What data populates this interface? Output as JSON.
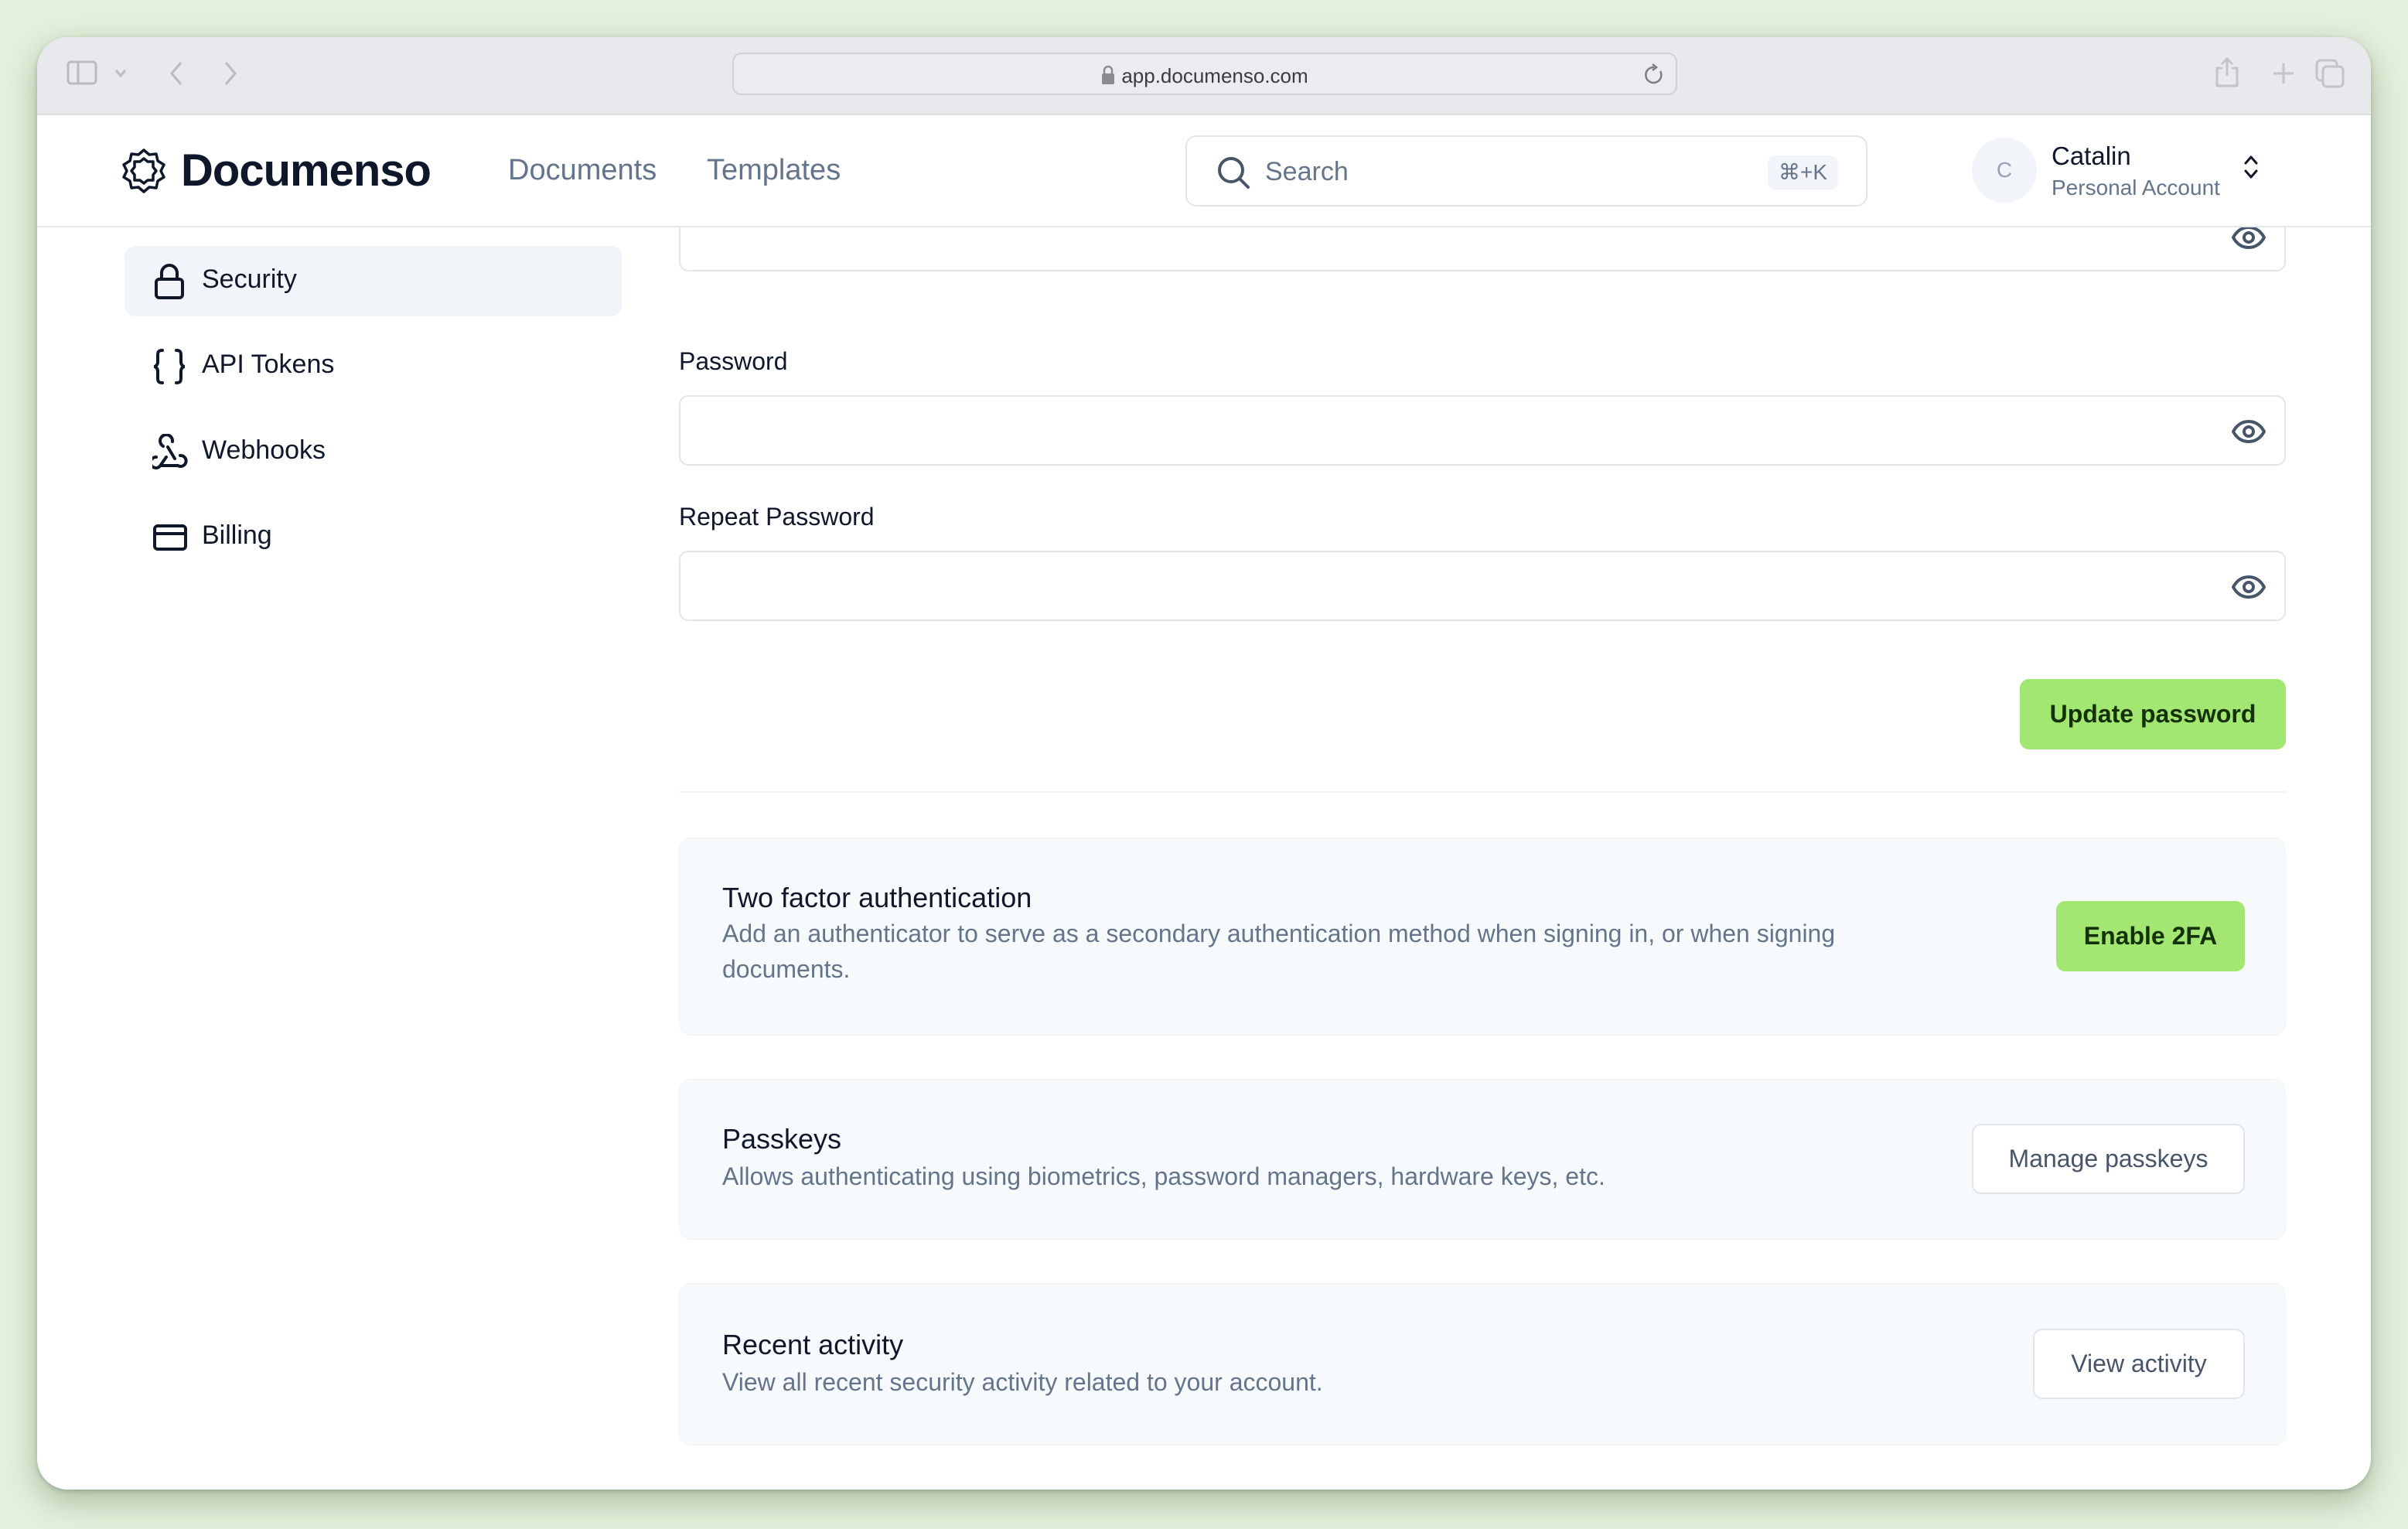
{
  "browser": {
    "url": "app.documenso.com"
  },
  "header": {
    "brand": "Documenso",
    "nav": [
      {
        "label": "Documents"
      },
      {
        "label": "Templates"
      }
    ],
    "search": {
      "placeholder": "Search",
      "shortcut": "⌘+K"
    },
    "user": {
      "initial": "C",
      "name": "Catalin",
      "account_type": "Personal Account"
    }
  },
  "sidebar": {
    "items": [
      {
        "label": "Security",
        "icon": "lock-icon",
        "active": true
      },
      {
        "label": "API Tokens",
        "icon": "braces-icon",
        "active": false
      },
      {
        "label": "Webhooks",
        "icon": "webhook-icon",
        "active": false
      },
      {
        "label": "Billing",
        "icon": "credit-card-icon",
        "active": false
      }
    ]
  },
  "password_form": {
    "current_password_value": "",
    "password_label": "Password",
    "password_value": "",
    "repeat_password_label": "Repeat Password",
    "repeat_password_value": "",
    "submit_label": "Update password"
  },
  "sections": {
    "two_factor": {
      "title": "Two factor authentication",
      "description": "Add an authenticator to serve as a secondary authentication method when signing in, or when signing documents.",
      "button": "Enable 2FA"
    },
    "passkeys": {
      "title": "Passkeys",
      "description": "Allows authenticating using biometrics, password managers, hardware keys, etc.",
      "button": "Manage passkeys"
    },
    "recent_activity": {
      "title": "Recent activity",
      "description": "View all recent security activity related to your account.",
      "button": "View activity"
    }
  },
  "colors": {
    "primary": "#a2e771",
    "primary_text": "#143109",
    "background": "#e3f0dc"
  }
}
